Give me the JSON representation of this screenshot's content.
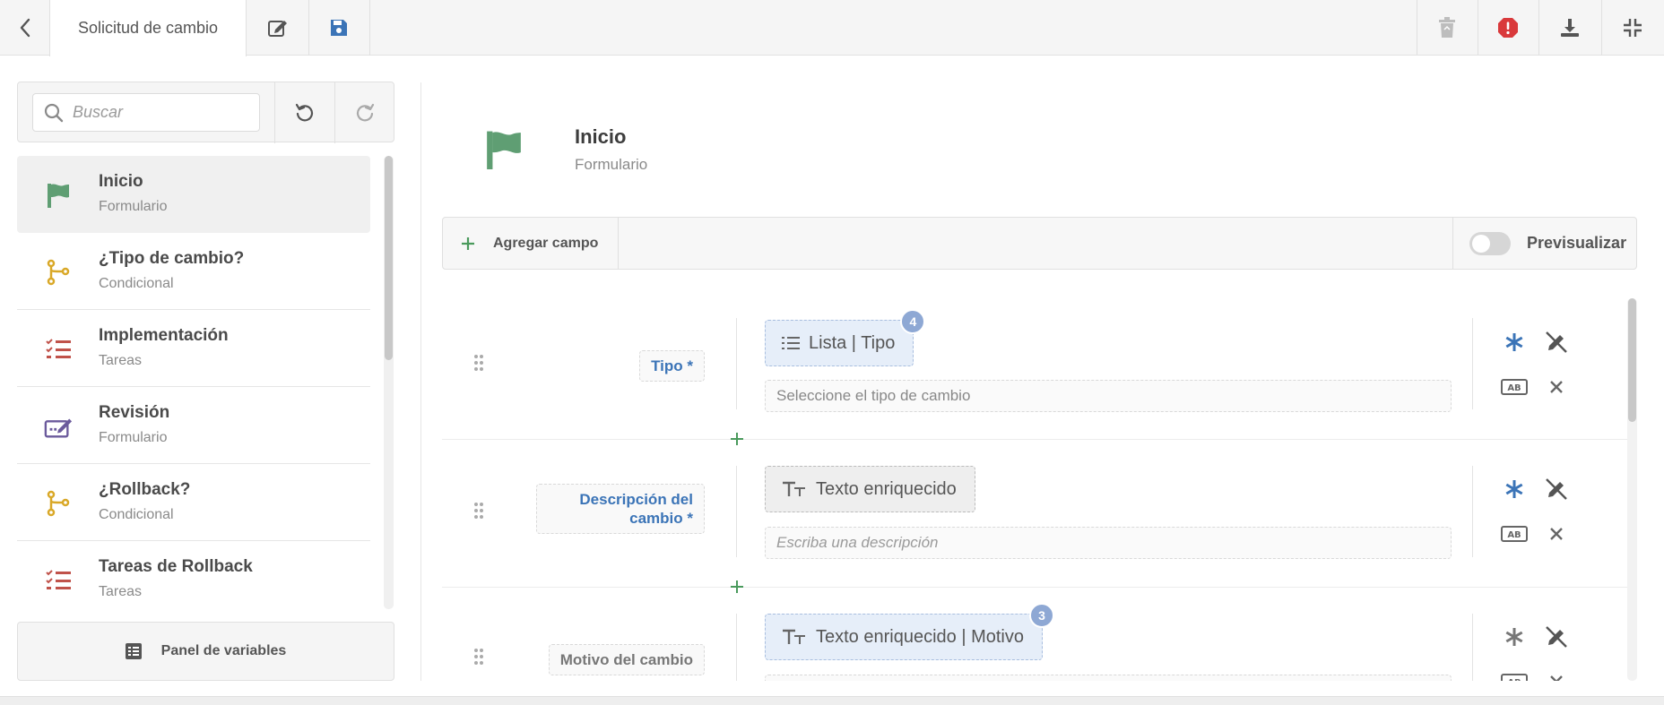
{
  "header": {
    "title": "Solicitud de cambio",
    "icons": [
      "back-chevron-icon",
      "edit-icon",
      "save-icon",
      "trash-icon",
      "error-octagon-icon",
      "download-icon",
      "collapse-icon"
    ]
  },
  "sidebar": {
    "search_placeholder": "Buscar",
    "steps": [
      {
        "name": "Inicio",
        "type": "Formulario",
        "icon": "flag-icon",
        "color": "#5f9e73"
      },
      {
        "name": "¿Tipo de cambio?",
        "type": "Condicional",
        "icon": "branch-icon",
        "color": "#d9a827"
      },
      {
        "name": "Implementación",
        "type": "Tareas",
        "icon": "tasklist-icon",
        "color": "#c0524a"
      },
      {
        "name": "Revisión",
        "type": "Formulario",
        "icon": "form-edit-icon",
        "color": "#6b5a9c"
      },
      {
        "name": "¿Rollback?",
        "type": "Condicional",
        "icon": "branch-icon",
        "color": "#d9a827"
      },
      {
        "name": "Tareas de Rollback",
        "type": "Tareas",
        "icon": "tasklist-icon",
        "color": "#c0524a"
      }
    ],
    "variables_panel": "Panel de variables"
  },
  "main": {
    "title": "Inicio",
    "subtitle": "Formulario",
    "add_field": "Agregar campo",
    "preview": "Previsualizar",
    "fields": [
      {
        "label": "Tipo *",
        "chip": "Lista | Tipo",
        "badge": "4",
        "placeholder": "Seleccione el tipo de cambio"
      },
      {
        "label_line1": "Descripción del",
        "label_line2": "cambio *",
        "chip": "Texto enriquecido",
        "placeholder": "Escriba una descripción"
      },
      {
        "label": "Motivo del cambio",
        "chip": "Texto enriquecido | Motivo",
        "badge": "3"
      }
    ]
  },
  "colors": {
    "accent_blue": "#3b74b7",
    "add_green": "#4a9a5c",
    "error_red": "#d9393b"
  }
}
